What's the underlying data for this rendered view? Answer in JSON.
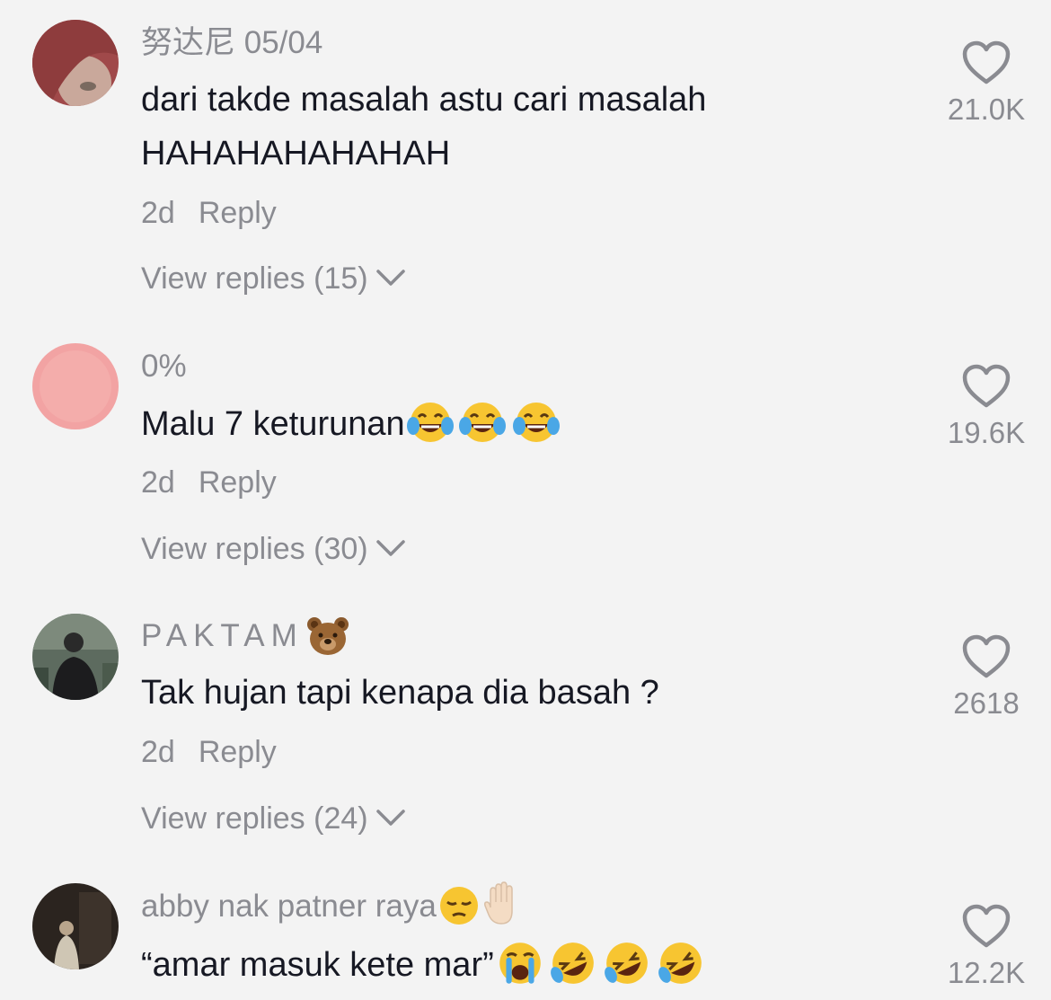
{
  "comments": [
    {
      "username": "努达尼 05/04",
      "text_line1": "dari takde masalah astu cari masalah",
      "text_line2": "HAHAHAHAHAHAH",
      "time": "2d",
      "reply_label": "Reply",
      "view_replies": "View replies (15)",
      "likes": "21.0K"
    },
    {
      "username": "0%",
      "text": "Malu 7 keturunan",
      "time": "2d",
      "reply_label": "Reply",
      "view_replies": "View replies (30)",
      "likes": "19.6K"
    },
    {
      "username": "PAKTAM",
      "text": "Tak hujan tapi kenapa dia basah ?",
      "time": "2d",
      "reply_label": "Reply",
      "view_replies": "View replies (24)",
      "likes": "2618"
    },
    {
      "username": "abby nak patner raya",
      "text": "“amar masuk kete mar”",
      "likes": "12.2K"
    }
  ],
  "colors": {
    "background": "#f3f3f3",
    "text": "#161823",
    "secondary": "#8a8b91"
  },
  "icons": [
    "heart-outline-icon",
    "chevron-down-icon",
    "tears-of-joy-emoji",
    "rofl-emoji",
    "loudly-crying-emoji",
    "bear-emoji",
    "pensive-emoji",
    "raised-hand-emoji"
  ]
}
